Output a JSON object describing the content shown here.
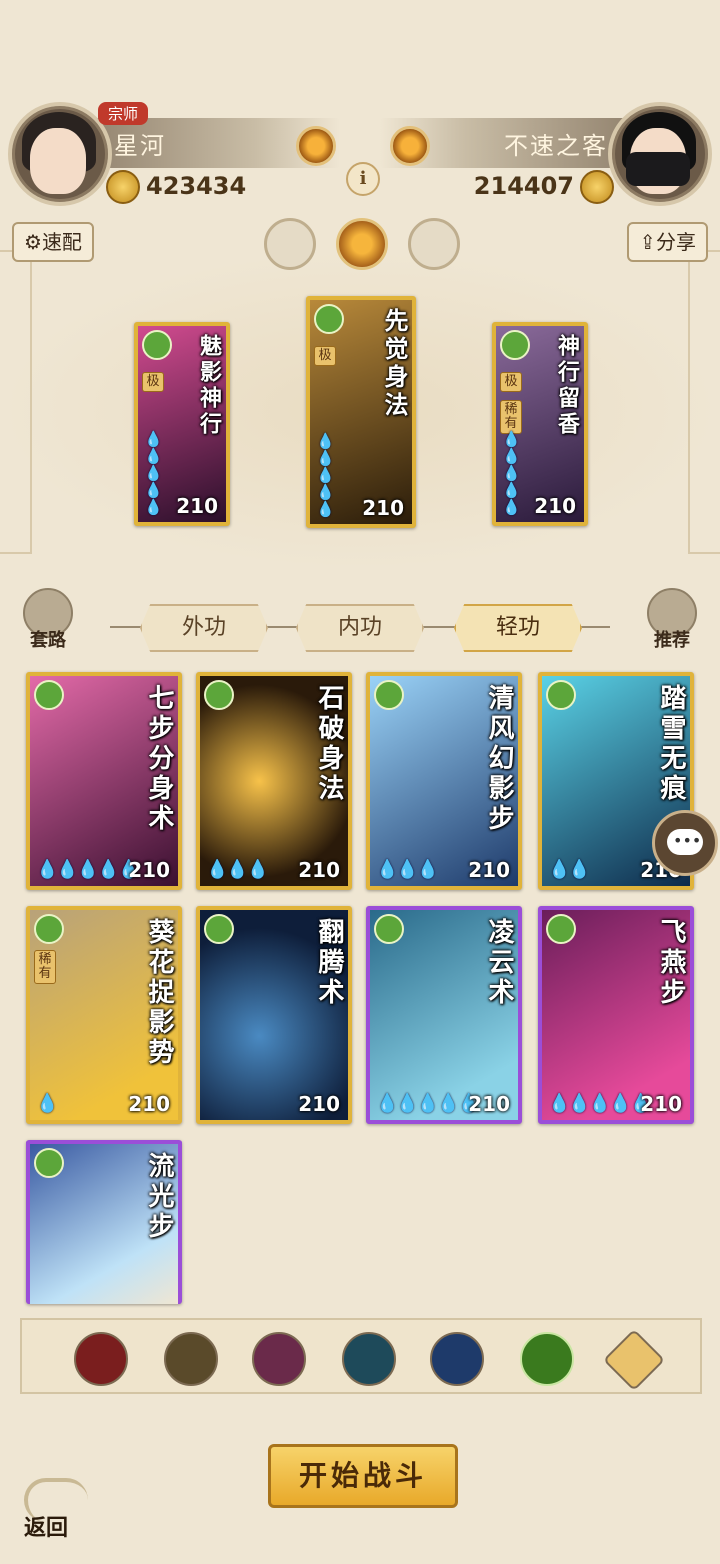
{
  "player": {
    "rank": "宗师",
    "name": "星河",
    "power": "423434"
  },
  "opponent": {
    "name": "不速之客",
    "power": "214407"
  },
  "info_icon": "i",
  "quick_match_label": "速配",
  "share_label": "分享",
  "element_icons": [
    "moon-icon",
    "sun-icon",
    "ring-icon"
  ],
  "selected": [
    {
      "name": "魅影神行",
      "tag": "极",
      "cost": "210",
      "drops": "💧💧💧💧💧"
    },
    {
      "name": "先觉身法",
      "tag": "极",
      "cost": "210",
      "drops": "💧💧💧💧💧"
    },
    {
      "name": "神行留香",
      "tag": "极",
      "tag2": "稀有",
      "cost": "210",
      "drops": "💧💧💧💧💧"
    }
  ],
  "side_left_label": "套路",
  "side_right_label": "推荐",
  "tabs": [
    "外功",
    "内功",
    "轻功"
  ],
  "active_tab": "轻功",
  "cards": [
    {
      "name": "七步分身术",
      "cost": "210",
      "drops": "💧💧💧💧💧",
      "frame": "gold",
      "bg": "#7a2b5a"
    },
    {
      "name": "石破身法",
      "cost": "210",
      "drops": "💧💧💧",
      "frame": "gold",
      "bg": "#4a3a1e"
    },
    {
      "name": "清风幻影步",
      "cost": "210",
      "drops": "💧💧💧",
      "frame": "gold",
      "bg": "#2d5a8a"
    },
    {
      "name": "踏雪无痕",
      "cost": "210",
      "drops": "💧💧",
      "frame": "gold",
      "bg": "#3a7a8e"
    },
    {
      "name": "葵花捉影势",
      "cost": "210",
      "drops": "💧",
      "frame": "gold",
      "bg": "#8a6a2a",
      "tag": "稀有"
    },
    {
      "name": "翻腾术",
      "cost": "210",
      "drops": "",
      "frame": "gold",
      "bg": "#1e3a6a"
    },
    {
      "name": "凌云术",
      "cost": "210",
      "drops": "💧💧💧💧💧",
      "frame": "purple",
      "bg": "#1e4a6a"
    },
    {
      "name": "飞燕步",
      "cost": "210",
      "drops": "💧💧💧💧💧",
      "frame": "purple",
      "bg": "#6a1e5a"
    },
    {
      "name": "流光步",
      "cost": "",
      "drops": "",
      "frame": "purple",
      "bg": "#2a4a8a"
    }
  ],
  "filter_icons": [
    {
      "name": "blade-filter-icon",
      "color": "#7a1e1e"
    },
    {
      "name": "sword-filter-icon",
      "color": "#5a4a2a"
    },
    {
      "name": "fist-filter-icon",
      "color": "#6a2a4a"
    },
    {
      "name": "fan-filter-icon",
      "color": "#1e4a5a"
    },
    {
      "name": "yinyang-filter-icon",
      "color": "#1e3a6a"
    },
    {
      "name": "movement-filter-icon",
      "color": "#3a7a1e"
    },
    {
      "name": "collapse-filter-icon",
      "color": "#e9c26c"
    }
  ],
  "start_label": "开始战斗",
  "back_label": "返回"
}
